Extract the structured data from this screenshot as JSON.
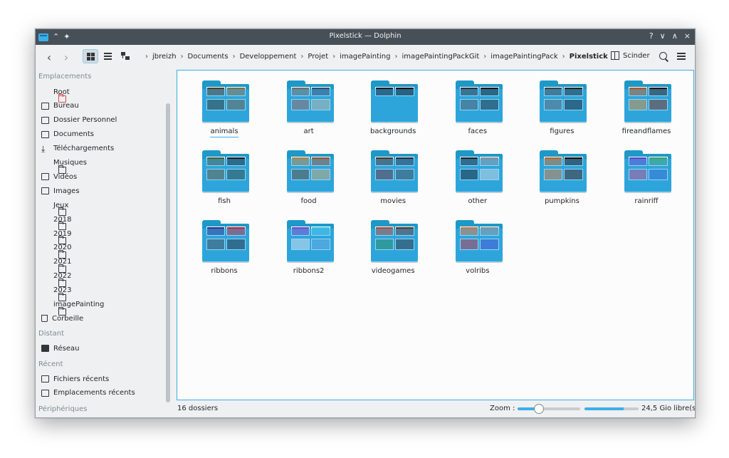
{
  "window": {
    "title": "Pixelstick — Dolphin"
  },
  "titlebar_controls": [
    "?",
    "∨",
    "∧",
    "×"
  ],
  "toolbar": {
    "back_glyph": "‹",
    "forward_glyph": "›",
    "split_label": "Scinder"
  },
  "breadcrumb": [
    "jbreizh",
    "Documents",
    "Developpement",
    "Projet",
    "imagePainting",
    "imagePaintingPackGit",
    "imagePaintingPack",
    "Pixelstick"
  ],
  "sidebar": {
    "sections": {
      "places": "Emplacements",
      "remote": "Distant",
      "recent": "Récent",
      "devices": "Périphériques"
    },
    "places": [
      {
        "label": "Root",
        "icon": "root-folder-icon"
      },
      {
        "label": "Bureau",
        "icon": "desktop-icon"
      },
      {
        "label": "Dossier Personnel",
        "icon": "home-icon"
      },
      {
        "label": "Documents",
        "icon": "documents-icon"
      },
      {
        "label": "Téléchargements",
        "icon": "download-icon"
      },
      {
        "label": "Musiques",
        "icon": "folder-icon"
      },
      {
        "label": "Vidéos",
        "icon": "video-icon"
      },
      {
        "label": "Images",
        "icon": "image-icon"
      },
      {
        "label": "Jeux",
        "icon": "folder-icon"
      },
      {
        "label": "2018",
        "icon": "folder-icon"
      },
      {
        "label": "2019",
        "icon": "folder-icon"
      },
      {
        "label": "2020",
        "icon": "folder-icon"
      },
      {
        "label": "2021",
        "icon": "folder-icon"
      },
      {
        "label": "2022",
        "icon": "folder-icon"
      },
      {
        "label": "2023",
        "icon": "folder-icon"
      },
      {
        "label": "imagePainting",
        "icon": "folder-icon"
      },
      {
        "label": "Corbeille",
        "icon": "trash-icon"
      }
    ],
    "remote": [
      {
        "label": "Réseau",
        "icon": "network-icon"
      }
    ],
    "recent": [
      {
        "label": "Fichiers récents",
        "icon": "recent-files-icon"
      },
      {
        "label": "Emplacements récents",
        "icon": "recent-places-icon"
      }
    ]
  },
  "folders": [
    {
      "name": "animals",
      "thumbs": [
        "#5a3a1a",
        "#8a6a3a",
        "#2a2a1a",
        "#6a5030"
      ]
    },
    {
      "name": "art",
      "thumbs": [
        "#7a6a5a",
        "#3a4a6a",
        "#9a5a4a",
        "#c0b090"
      ]
    },
    {
      "name": "backgrounds",
      "thumbs": [
        "#101820",
        "#0a0a0a"
      ]
    },
    {
      "name": "faces",
      "thumbs": [
        "#303030",
        "#101010",
        "#505050",
        "#202020"
      ]
    },
    {
      "name": "figures",
      "thumbs": [
        "#404040",
        "#202020",
        "#606060",
        "#151515"
      ]
    },
    {
      "name": "fireandflames",
      "thumbs": [
        "#c05010",
        "#301008",
        "#e08020",
        "#802000"
      ]
    },
    {
      "name": "fish",
      "thumbs": [
        "#4a5a3a",
        "#1a1a1a",
        "#6a5020",
        "#2a3a2a"
      ]
    },
    {
      "name": "food",
      "thumbs": [
        "#c08030",
        "#a05020",
        "#604020",
        "#d0a060"
      ]
    },
    {
      "name": "movies",
      "thumbs": [
        "#503020",
        "#2a2a3a",
        "#6a2020",
        "#404040"
      ]
    },
    {
      "name": "other",
      "thumbs": [
        "#202020",
        "#909090",
        "#101010",
        "#d0d0d0"
      ]
    },
    {
      "name": "pumpkins",
      "thumbs": [
        "#d06010",
        "#200800",
        "#e07020",
        "#401000"
      ]
    },
    {
      "name": "rainriff",
      "thumbs": [
        "#6040c0",
        "#40a060",
        "#c04080",
        "#3060c0"
      ]
    },
    {
      "name": "ribbons",
      "thumbs": [
        "#303080",
        "#c02030",
        "#404040",
        "#202020"
      ]
    },
    {
      "name": "ribbons2",
      "thumbs": [
        "#8040c0",
        "#40c0e0",
        "#e0e0e0",
        "#60a0d0"
      ]
    },
    {
      "name": "videogames",
      "thumbs": [
        "#c04020",
        "#603020",
        "#208040",
        "#302020"
      ]
    },
    {
      "name": "volribs",
      "thumbs": [
        "#e07030",
        "#909090",
        "#c02030",
        "#4040c0"
      ]
    }
  ],
  "status": {
    "count": "16 dossiers",
    "zoom_label": "Zoom :",
    "zoom_level": 0.33,
    "free_space": "24,5 Gio libre(s)",
    "used_fraction": 0.72
  },
  "colors": {
    "accent": "#3daee9",
    "titlebar": "#475057"
  }
}
